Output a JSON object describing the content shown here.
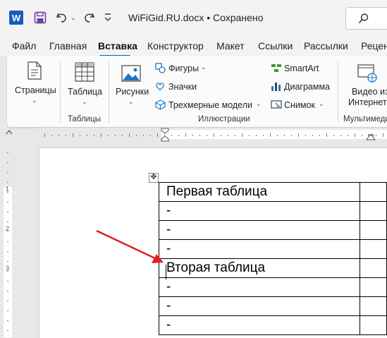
{
  "titlebar": {
    "app_icon": "word-logo-icon",
    "app_letter": "W",
    "save": "save-icon",
    "undo": "undo-icon",
    "redo": "redo-icon",
    "customize": "customize-icon",
    "document_title": "WiFiGid.RU.docx • Сохранено",
    "search": "search-icon"
  },
  "tabs": [
    "Файл",
    "Главная",
    "Вставка",
    "Конструктор",
    "Макет",
    "Ссылки",
    "Рассылки",
    "Рецен"
  ],
  "active_tab": "Вставка",
  "ribbon": {
    "pages": "Страницы",
    "table": "Таблица",
    "tables_group": "Таблицы",
    "pictures": "Рисунки",
    "shapes": "Фигуры",
    "icons": "Значки",
    "models3d": "Трехмерные модели",
    "smartart": "SmartArt",
    "chart": "Диаграмма",
    "screenshot": "Снимок",
    "illustrations_group": "Иллюстрации",
    "video_line1": "Видео из",
    "video_line2": "Интернета",
    "media_group": "Мультимеди"
  },
  "ruler": {
    "vertical_numbers": [
      "1",
      "2",
      "3"
    ]
  },
  "document": {
    "rows": [
      "Первая таблица",
      "-",
      "-",
      "-",
      "Вторая таблица",
      "-",
      "-",
      "-"
    ]
  },
  "colors": {
    "accent": "#185abd",
    "arrow": "#e02020"
  }
}
